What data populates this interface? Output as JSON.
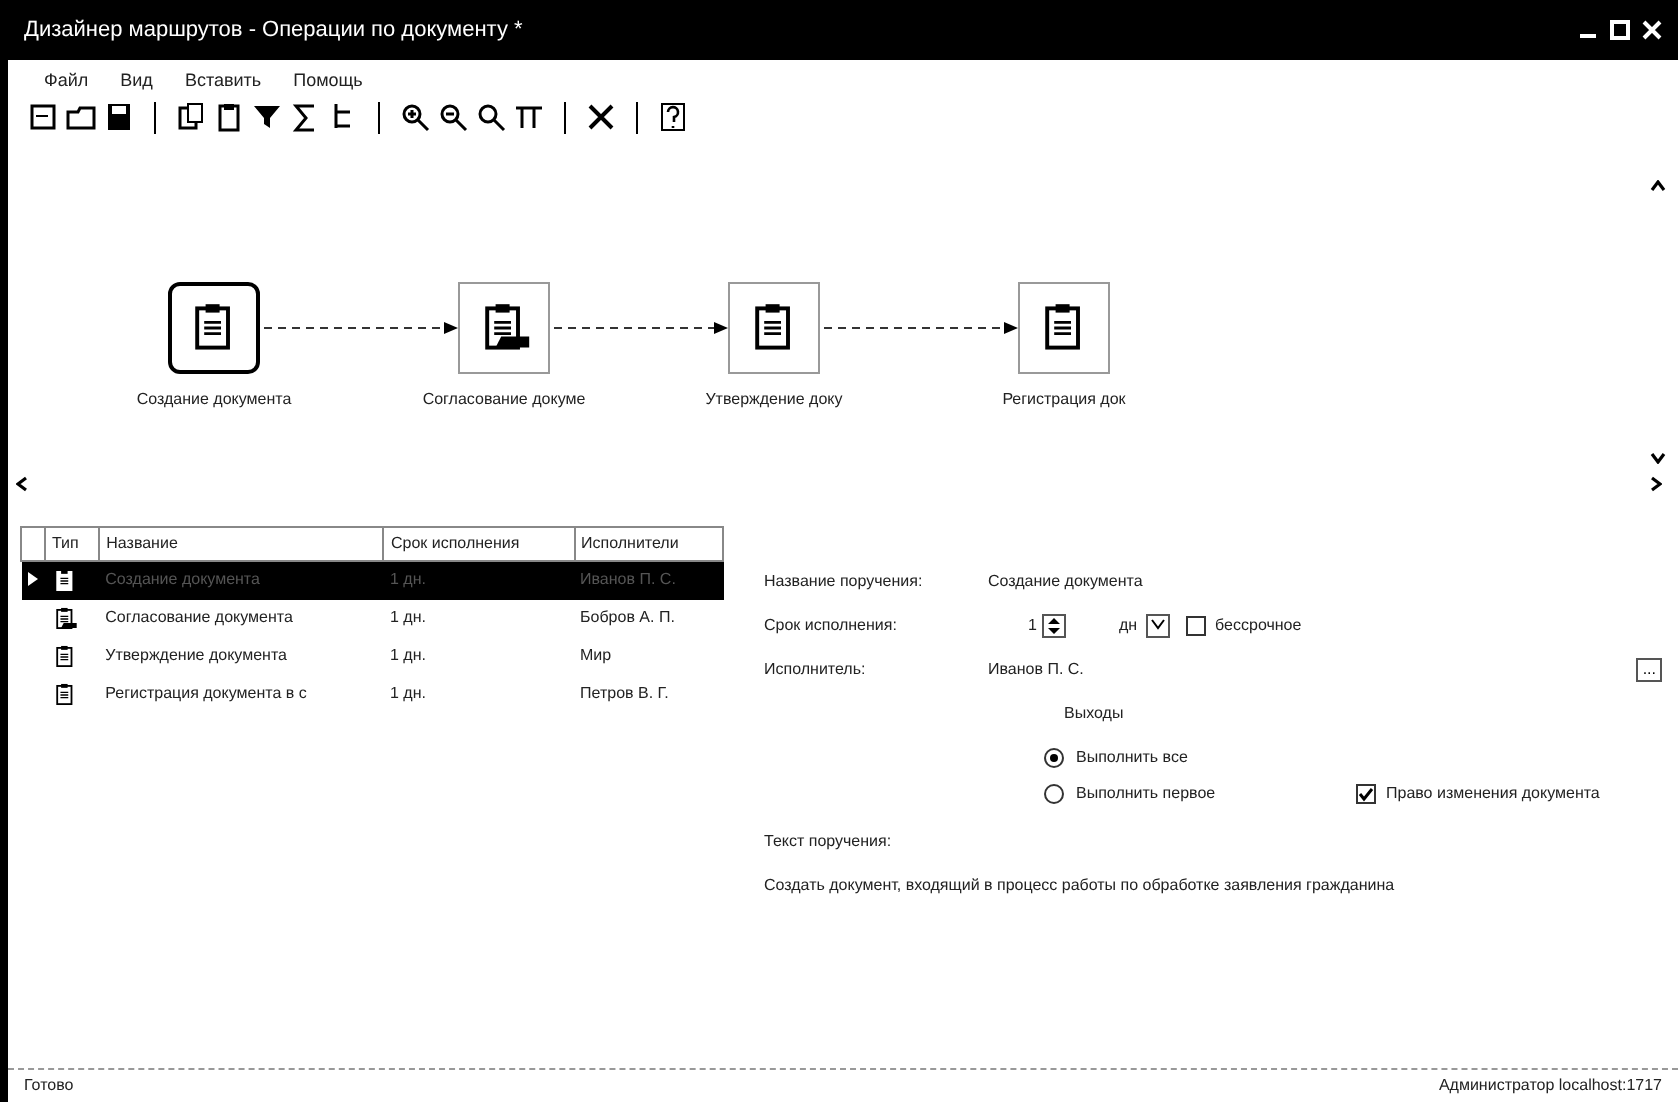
{
  "window": {
    "title": "Дизайнер маршрутов - Операции по документу *"
  },
  "menu": [
    "Файл",
    "Вид",
    "Вставить",
    "Помощь"
  ],
  "route": [
    {
      "label": "Создание документа",
      "selected": true,
      "kind": "doc"
    },
    {
      "label": "Согласование докуме",
      "selected": false,
      "kind": "approve"
    },
    {
      "label": "Утверждение доку",
      "selected": false,
      "kind": "doc"
    },
    {
      "label": "Регистрация док",
      "selected": false,
      "kind": "doc"
    }
  ],
  "table": {
    "columns": [
      "Тип",
      "Название",
      "Срок исполнения",
      "Исполнители"
    ],
    "rows": [
      {
        "kind": "doc",
        "name": "Создание документа",
        "term": "1 дн.",
        "performer": "Иванов П. С.",
        "selected": true
      },
      {
        "kind": "approve",
        "name": "Согласование документа",
        "term": "1 дн.",
        "performer": "Бобров А. П.",
        "selected": false
      },
      {
        "kind": "doc",
        "name": "Утверждение документа",
        "term": "1 дн.",
        "performer": "Мир",
        "selected": false
      },
      {
        "kind": "doc",
        "name": "Регистрация документа в с",
        "term": "1 дн.",
        "performer": "Петров В. Г.",
        "selected": false
      }
    ]
  },
  "form": {
    "name_label": "Название поручения:",
    "name_value": "Создание документа",
    "term_label": "Срок исполнения:",
    "term_value": "1",
    "term_unit": "дн",
    "unlimited": {
      "label": "бессрочное",
      "checked": false
    },
    "performer_label": "Исполнитель:",
    "performer_value": "Иванов П. С.",
    "browse": "...",
    "outputs_title": "Выходы",
    "outputs": [
      {
        "label": "Выполнить все",
        "selected": true
      },
      {
        "label": "Выполнить первое",
        "selected": false
      }
    ],
    "edit_right": {
      "label": "Право изменения документа",
      "checked": true
    },
    "text_label": "Текст поручения:",
    "text_value": "Создать документ, входящий в процесс работы по обработке заявления гражданина"
  },
  "status_bar": {
    "left": "Готово",
    "right": "Администратор localhost:1717"
  }
}
